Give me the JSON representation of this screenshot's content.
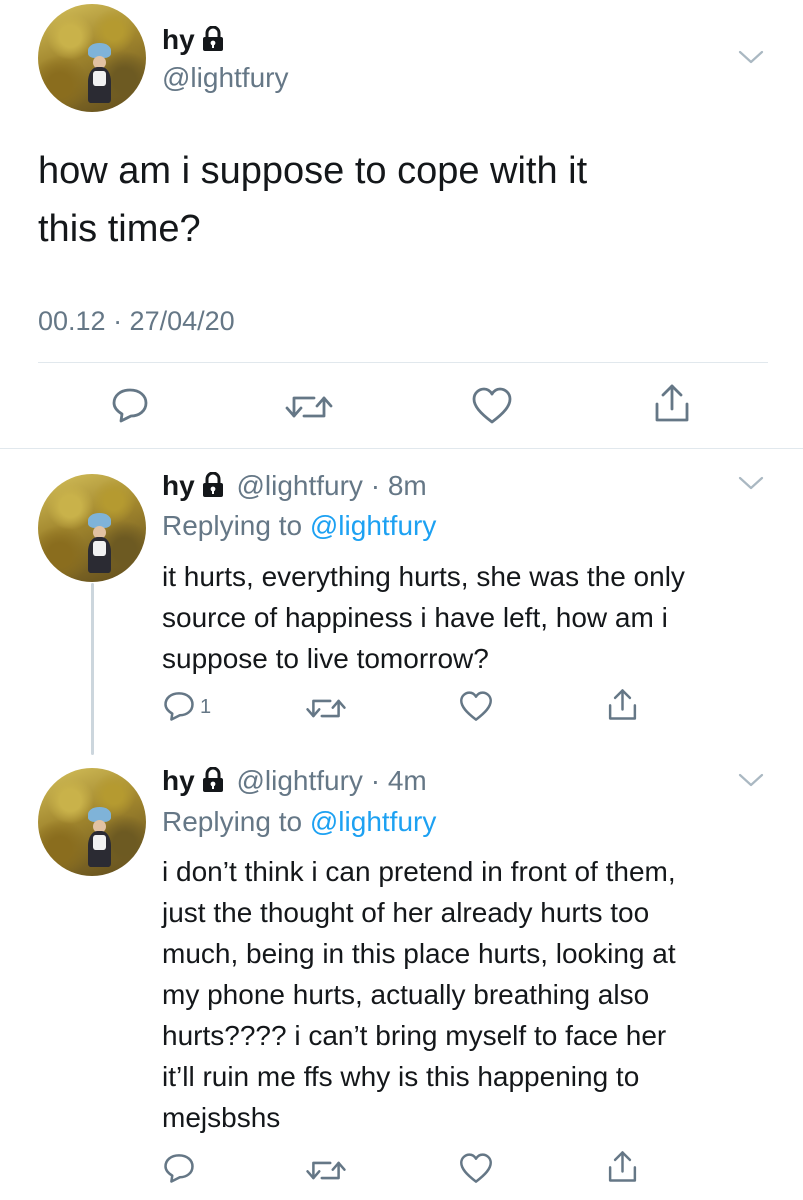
{
  "main_tweet": {
    "name": "hy",
    "handle": "@lightfury",
    "text_line1": "how am i suppose to cope with it",
    "text_line2": "this time?",
    "timestamp": "00.12 · 27/04/20"
  },
  "replies": [
    {
      "name": "hy",
      "handle_time": "@lightfury · 8m",
      "replying_prefix": "Replying to ",
      "replying_mention": "@lightfury",
      "lines": [
        "it hurts, everything hurts, she was the only",
        "source of happiness i have left, how am i",
        "suppose to live tomorrow?"
      ],
      "reply_count": "1"
    },
    {
      "name": "hy",
      "handle_time": "@lightfury · 4m",
      "replying_prefix": "Replying to ",
      "replying_mention": "@lightfury",
      "lines": [
        "i don’t think i can pretend in front of them,",
        "just the thought of her already hurts too",
        "much, being in this place hurts, looking at",
        "my phone hurts, actually breathing also",
        "hurts???? i can’t bring myself to face her",
        "it’ll ruin me ffs why is this happening to",
        "mejsbshs"
      ]
    }
  ],
  "colors": {
    "text": "#14171a",
    "secondary": "#657786",
    "link": "#1da1f2",
    "divider": "#e1e8ed",
    "thread_line": "#ccd6dd"
  },
  "icons": {
    "lock": "lock-icon",
    "chevron": "chevron-down-icon",
    "reply": "reply-icon",
    "retweet": "retweet-icon",
    "like": "like-icon",
    "share": "share-icon"
  }
}
